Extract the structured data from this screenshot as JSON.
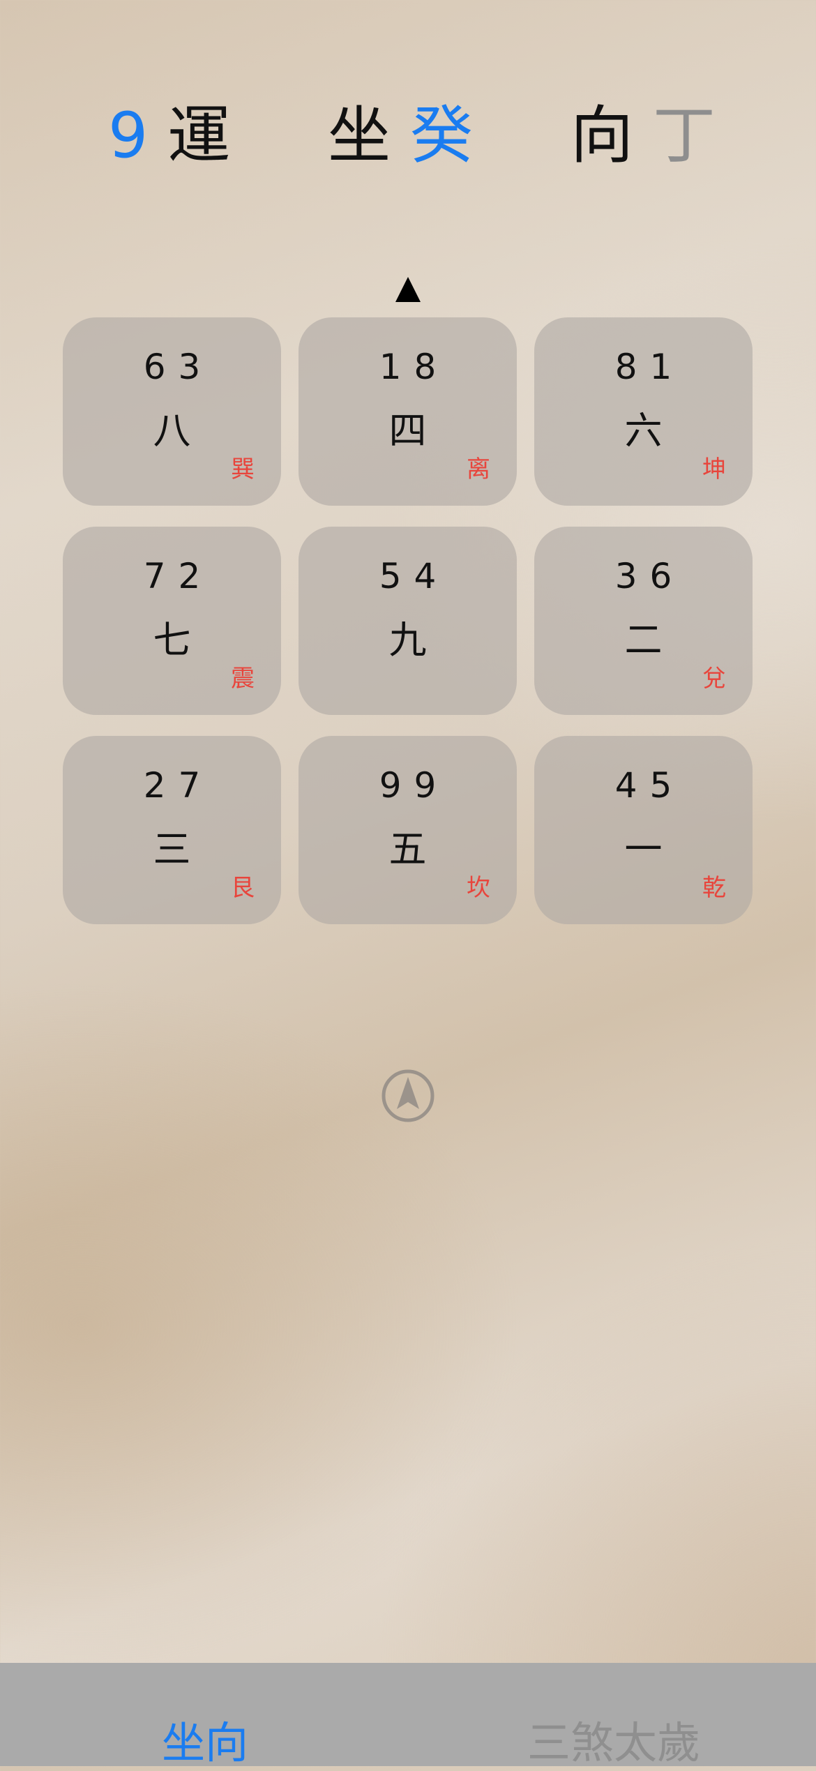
{
  "header": {
    "yun_number": "9",
    "yun_label": "運",
    "sit_label": "坐",
    "sit_value": "癸",
    "face_label": "向",
    "face_value": "丁"
  },
  "icons": {
    "top_arrow": "up-triangle-icon",
    "compass": "navigation-arrow-icon"
  },
  "colors": {
    "accent_blue": "#1a7cf0",
    "trigram_red": "#e8453c",
    "muted_grey": "#8e8e8e"
  },
  "grid": {
    "cells": [
      {
        "stars": "63",
        "period": "八",
        "trigram": "巽"
      },
      {
        "stars": "18",
        "period": "四",
        "trigram": "离"
      },
      {
        "stars": "81",
        "period": "六",
        "trigram": "坤"
      },
      {
        "stars": "72",
        "period": "七",
        "trigram": "震"
      },
      {
        "stars": "54",
        "period": "九",
        "trigram": ""
      },
      {
        "stars": "36",
        "period": "二",
        "trigram": "兌"
      },
      {
        "stars": "27",
        "period": "三",
        "trigram": "艮"
      },
      {
        "stars": "99",
        "period": "五",
        "trigram": "坎"
      },
      {
        "stars": "45",
        "period": "一",
        "trigram": "乾"
      }
    ]
  },
  "tabs": [
    {
      "label": "坐向",
      "active": true
    },
    {
      "label": "三煞太歲",
      "active": false
    }
  ]
}
